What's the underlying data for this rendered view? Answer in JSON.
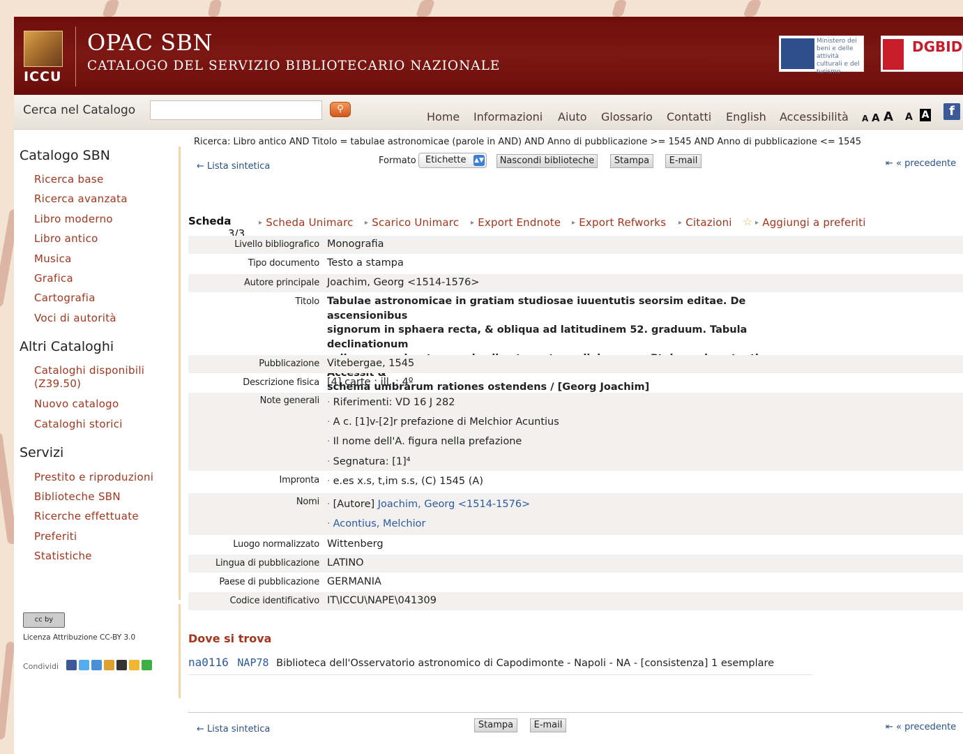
{
  "header": {
    "logo_text": "ICCU",
    "title": "OPAC SBN",
    "subtitle": "CATALOGO DEL SERVIZIO BIBLIOTECARIO NAZIONALE",
    "mibac_text": "Ministero dei beni e delle attività culturali e del turismo",
    "dgbid_text": "DGBID"
  },
  "navbar": {
    "search_label": "Cerca nel Catalogo",
    "search_placeholder": "",
    "search_value": "",
    "links": [
      "Home",
      "Informazioni",
      "Aiuto",
      "Glossario",
      "Contatti",
      "English",
      "Accessibilità"
    ],
    "font_sizes": [
      "A",
      "A",
      "A"
    ],
    "font_contrast_a": "A",
    "font_contrast_b": "A"
  },
  "sidebar": {
    "catalogo_heading": "Catalogo SBN",
    "catalogo_items": [
      "Ricerca base",
      "Ricerca avanzata",
      "Libro moderno",
      "Libro antico",
      "Musica",
      "Grafica",
      "Cartografia",
      "Voci di autorità"
    ],
    "altri_heading": "Altri Cataloghi",
    "altri_items": [
      "Cataloghi disponibili (Z39.50)",
      "Nuovo catalogo",
      "Cataloghi storici"
    ],
    "servizi_heading": "Servizi",
    "servizi_items": [
      "Prestito e riproduzioni",
      "Biblioteche SBN",
      "Ricerche effettuate",
      "Preferiti",
      "Statistiche"
    ],
    "license": "Licenza Attribuzione CC-BY 3.0",
    "share_label": "Condividi",
    "cc_badge": "cc  by"
  },
  "main": {
    "search_query": "Ricerca: Libro antico AND Titolo = tabulae astronomicae (parole in AND) AND Anno di pubblicazione >= 1545 AND Anno di pubblicazione <= 1545",
    "back_link": "Lista sintetica",
    "format_label": "Formato",
    "format_value": "Etichette",
    "hide_libraries": "Nascondi biblioteche",
    "print": "Stampa",
    "email": "E-mail",
    "previous": "precedente",
    "scheda_label": "Scheda",
    "scheda_value": ": 3/3",
    "tabs": [
      "Scheda Unimarc",
      "Scarico Unimarc",
      "Export Endnote",
      "Export Refworks",
      "Citazioni",
      "Aggiungi a preferiti"
    ],
    "record": {
      "livello_label": "Livello bibliografico",
      "livello": "Monografia",
      "tipo_label": "Tipo documento",
      "tipo": "Testo a stampa",
      "autore_label": "Autore principale",
      "autore": "Joachim, Georg <1514-1576>",
      "titolo_label": "Titolo",
      "titolo_lines": [
        "Tabulae astronomicae in gratiam studiosae iuuentutis seorsim editae. De ascensionibus",
        "signorum in sphaera recta, & obliqua ad latitudinem 52. graduum. Tabula declinationum",
        "solis per quadrantem. ordo climatum et parallelorum ex Ptolemaei sententia. Accessit &",
        "schema umbrarum rationes ostendens / [Georg Joachim]"
      ],
      "pub_label": "Pubblicazione",
      "pub": "Vitebergae, 1545",
      "desc_label": "Descrizione fisica",
      "desc": "[4] carte : ill. ; 4º",
      "note_label": "Note generali",
      "notes": [
        "Riferimenti: VD 16 J 282",
        "A c. [1]v-[2]r prefazione di Melchior Acuntius",
        "Il nome dell'A. figura nella prefazione",
        "Segnatura: [1]⁴"
      ],
      "impronta_label": "Impronta",
      "impronta": "e.es x.s, t,im s.s, (C) 1545 (A)",
      "nomi_label": "Nomi",
      "nomi_prefix": "[Autore]",
      "nomi_1": "Joachim, Georg <1514-1576>",
      "nomi_2": "Acontius, Melchior",
      "luogo_label": "Luogo normalizzato",
      "luogo": "Wittenberg",
      "lingua_label": "Lingua di pubblicazione",
      "lingua": "LATINO",
      "paese_label": "Paese di pubblicazione",
      "paese": "GERMANIA",
      "codice_label": "Codice identificativo",
      "codice": "IT\\ICCU\\NAPE\\041309"
    },
    "dove_heading": "Dove si trova",
    "holding": {
      "code1": "na0116",
      "code2": "NAP78",
      "text": "Biblioteca dell'Osservatorio astronomico di Capodimonte - Napoli - NA - [consistenza] 1 esemplare"
    }
  }
}
